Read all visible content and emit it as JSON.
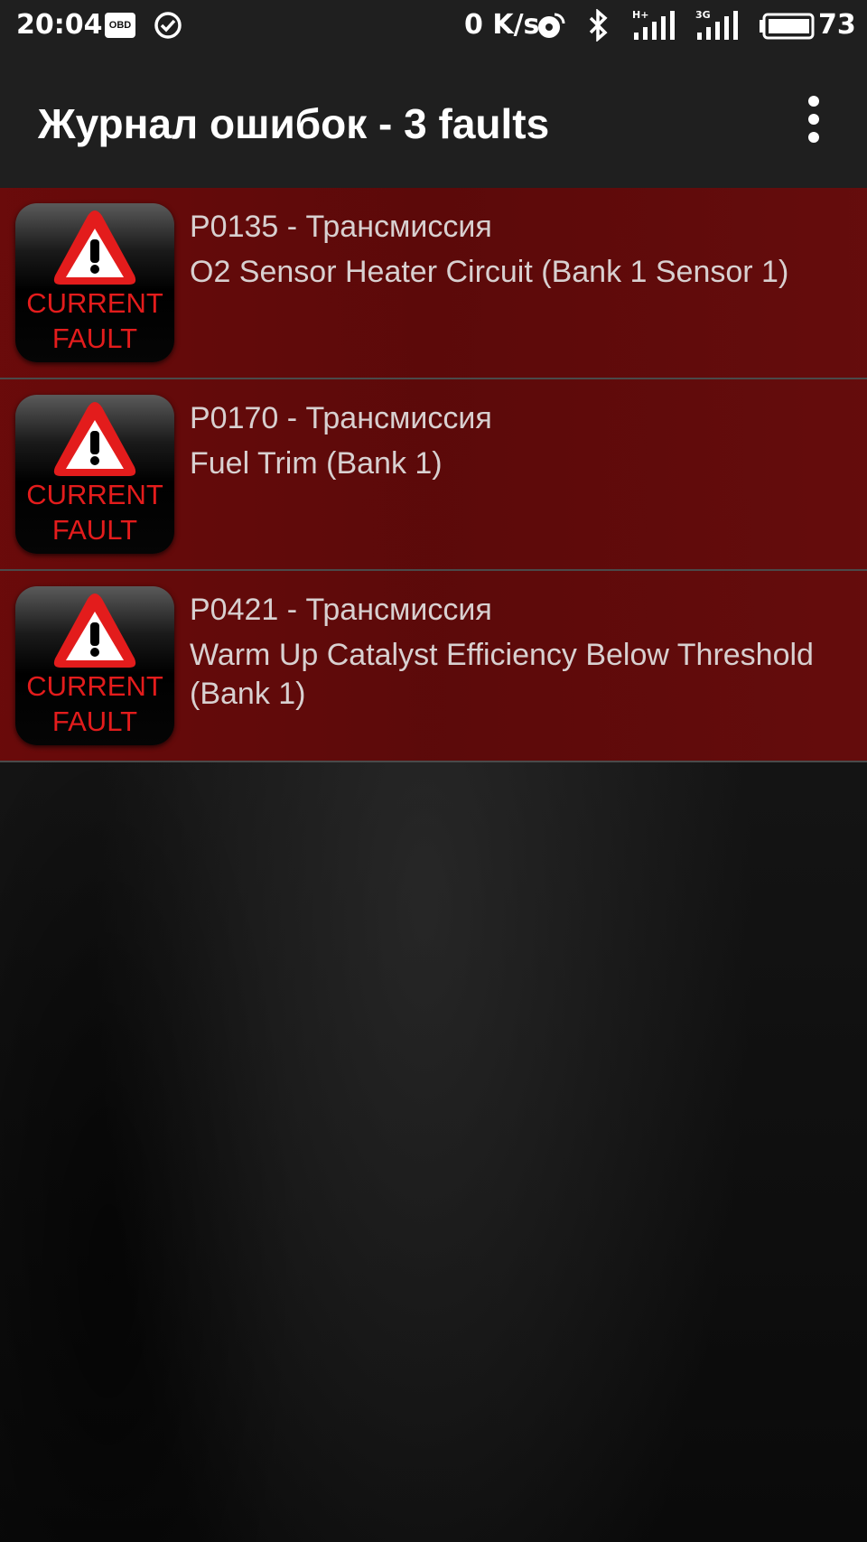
{
  "status_bar": {
    "time": "20:04",
    "obd_badge": "OBD",
    "net_speed": "0 K/s",
    "signal_1_type": "H+",
    "signal_2_type": "3G",
    "battery": "73"
  },
  "app_bar": {
    "title": "Журнал ошибок - 3 faults",
    "menu_icon": "more-vert-icon"
  },
  "faults": [
    {
      "icon_line1": "CURRENT",
      "icon_line2": "FAULT",
      "code": "P0135 - Трансмиссия",
      "description": "O2 Sensor Heater Circuit (Bank 1 Sensor 1)"
    },
    {
      "icon_line1": "CURRENT",
      "icon_line2": "FAULT",
      "code": "P0170 - Трансмиссия",
      "description": "Fuel Trim (Bank 1)"
    },
    {
      "icon_line1": "CURRENT",
      "icon_line2": "FAULT",
      "code": "P0421 - Трансмиссия",
      "description": "Warm Up Catalyst Efficiency Below Threshold (Bank 1)"
    }
  ],
  "colors": {
    "row_background": "#6e0a0a",
    "icon_red": "#e31c1c",
    "text": "#d8d0d0",
    "bar_background": "#1f1f1f"
  }
}
